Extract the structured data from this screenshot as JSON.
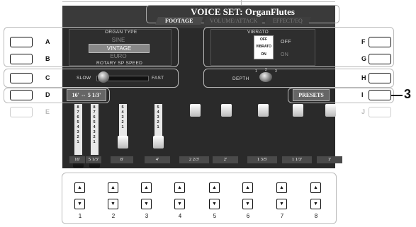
{
  "title": "VOICE SET: OrganFlutes",
  "tabs": [
    "FOOTAGE",
    "VOLUME/ATTACK",
    "EFFECT/EQ"
  ],
  "left_keys": [
    "A",
    "B",
    "C",
    "D",
    "E"
  ],
  "right_keys": [
    "F",
    "G",
    "H",
    "I",
    "J"
  ],
  "organ_type": {
    "label": "ORGAN TYPE",
    "options": [
      "SINE",
      "VINTAGE",
      "EURO"
    ],
    "selected": "VINTAGE"
  },
  "rotary": {
    "label": "ROTARY SP SPEED",
    "slow": "SLOW",
    "fast": "FAST"
  },
  "footage_button": "16' ⇔ 5 1/3'",
  "vibrato": {
    "label": "VIBRATO",
    "off": "OFF",
    "vibrato": "VIBRATO",
    "on": "ON",
    "right_off": "OFF",
    "right_on": "ON",
    "depth": "DEPTH",
    "depth_scale": [
      "1",
      "2",
      "3"
    ]
  },
  "presets_button": "PRESETS",
  "callout": "3",
  "drawbars": {
    "feet": [
      "16'",
      "5 1/3'",
      "8'",
      "4'",
      "2 2/3'",
      "2'",
      "1 3/5'",
      "1 1/3'",
      "1'"
    ],
    "levels": [
      8,
      8,
      5,
      5,
      0,
      0,
      0,
      0,
      0
    ],
    "scale_numbers": "87654321"
  },
  "bottom_buttons": {
    "up_glyph": "▲",
    "down_glyph": "▼",
    "numbers": [
      "1",
      "2",
      "3",
      "4",
      "5",
      "6",
      "7",
      "8"
    ]
  }
}
